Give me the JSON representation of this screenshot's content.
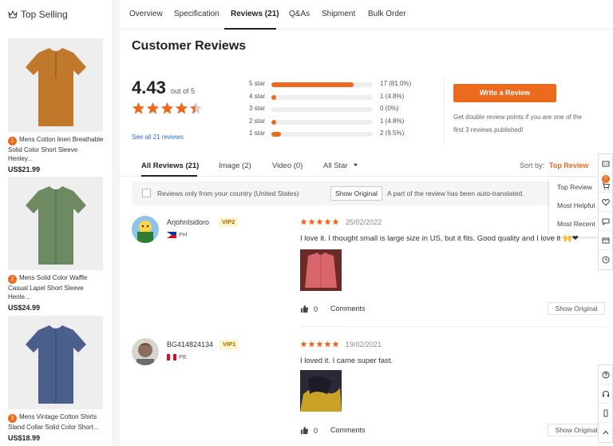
{
  "sidebar": {
    "title": "Top Selling",
    "products": [
      {
        "rank": "1",
        "name_line1": "Mens Cotton linen Breathable",
        "name_line2": "Solid Color Short Sleeve Henley...",
        "price": "US$21.99",
        "color": "#c0782a"
      },
      {
        "rank": "2",
        "name_line1": "Mens Solid Color Waffle",
        "name_line2": "Casual Lapel Short Sleeve Henle...",
        "price": "US$24.99",
        "color": "#6e8a63"
      },
      {
        "rank": "3",
        "name_line1": "Mens Vintage Cotton Shirts",
        "name_line2": "Stand Collar Solid Color Short...",
        "price": "US$18.99",
        "color": "#4a5f8c"
      }
    ]
  },
  "tabs": [
    "Overview",
    "Specification",
    "Reviews (21)",
    "Q&As",
    "Shipment",
    "Bulk Order"
  ],
  "reviews_section": {
    "title": "Customer Reviews",
    "average": "4.43",
    "out_of": "out of 5",
    "average_stars": 4.43,
    "see_all": "See all 21 reviews",
    "distribution": [
      {
        "label": "5 star",
        "count": "17 (81.0%)",
        "fraction": 0.81
      },
      {
        "label": "4 star",
        "count": "1 (4.8%)",
        "fraction": 0.048
      },
      {
        "label": "3 star",
        "count": "0 (0%)",
        "fraction": 0
      },
      {
        "label": "2 star",
        "count": "1 (4.8%)",
        "fraction": 0.048
      },
      {
        "label": "1 star",
        "count": "2 (9.5%)",
        "fraction": 0.095
      }
    ],
    "write_button": "Write a Review",
    "write_note_line1": "Get double review points if you are one of the",
    "write_note_line2": "first 3 reviews published!"
  },
  "filters": {
    "all": "All Reviews (21)",
    "image": "Image (2)",
    "video": "Video (0)",
    "all_star": "All Star",
    "sort_by_label": "Sort by:",
    "sort_by_value": "Top Review"
  },
  "sort_options": [
    "Top Review",
    "Most Helpful",
    "Most Recent"
  ],
  "toolbar": {
    "checkbox_label": "Reviews only from your country (United States)",
    "show_original_button": "Show Original",
    "auto_translated_note": "A part of the review has been auto-translated."
  },
  "reviews": [
    {
      "user": "ArjohnIsidoro",
      "vip": "VIP2",
      "country": "PH",
      "rating": 5,
      "date": "25/02/2022",
      "text": "I love it. I thought small is large size in US, but it fits. Good quality and I love it 🙌❤",
      "likes": "0",
      "comments_label": "Comments",
      "show_original": "Show Original",
      "photo_color": "#c9524a"
    },
    {
      "user": "BG414824134",
      "vip": "VIP1",
      "country": "PE",
      "rating": 5,
      "date": "19/02/2021",
      "text": "I loved it. I came super fast.",
      "likes": "0",
      "comments_label": "Comments",
      "show_original": "Show Original",
      "photo_color": "#3b3a4a"
    }
  ],
  "right_rail": {
    "cart_count": "0"
  },
  "colors": {
    "accent": "#ec6a1d",
    "link": "#2c6bd6"
  }
}
